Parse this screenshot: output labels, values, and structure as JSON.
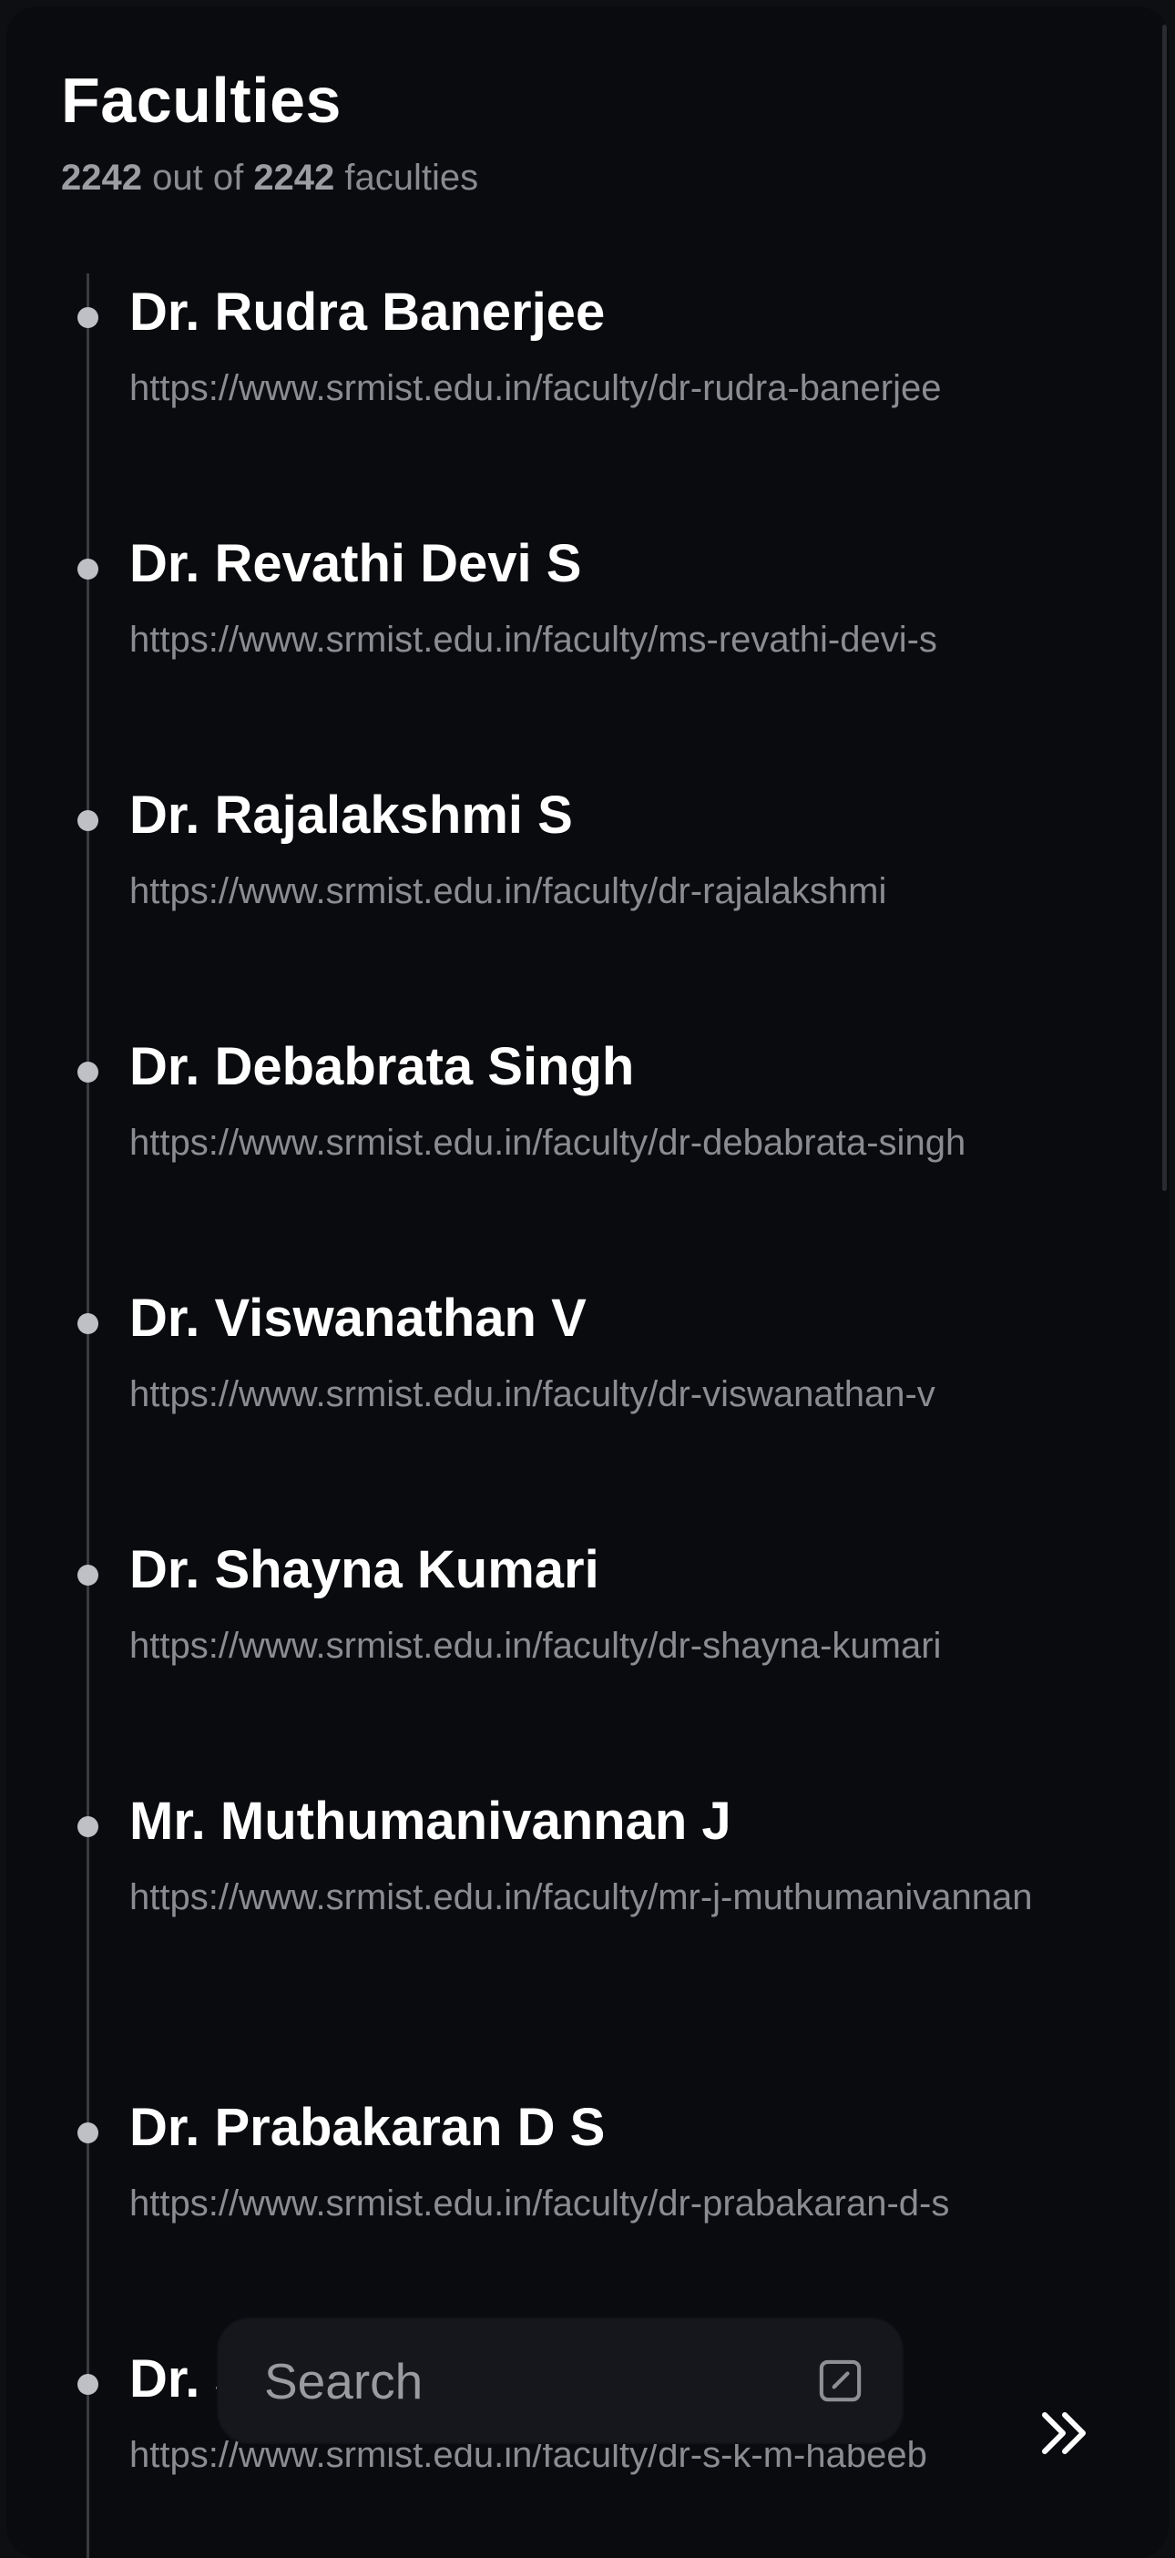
{
  "header": {
    "title": "Faculties",
    "shown_count": "2242",
    "out_of": "out of",
    "total_count": "2242",
    "unit": "faculties"
  },
  "faculties": [
    {
      "name": "Dr. Rudra Banerjee",
      "url": "https://www.srmist.edu.in/faculty/dr-rudra-banerjee"
    },
    {
      "name": "Dr. Revathi Devi S",
      "url": "https://www.srmist.edu.in/faculty/ms-revathi-devi-s"
    },
    {
      "name": "Dr. Rajalakshmi S",
      "url": "https://www.srmist.edu.in/faculty/dr-rajalakshmi"
    },
    {
      "name": "Dr. Debabrata Singh",
      "url": "https://www.srmist.edu.in/faculty/dr-debabrata-singh"
    },
    {
      "name": "Dr. Viswanathan V",
      "url": "https://www.srmist.edu.in/faculty/dr-viswanathan-v"
    },
    {
      "name": "Dr. Shayna Kumari",
      "url": "https://www.srmist.edu.in/faculty/dr-shayna-kumari"
    },
    {
      "name": "Mr. Muthumanivannan J",
      "url": "https://www.srmist.edu.in/faculty/mr-j-muthumanivannan"
    },
    {
      "name": "Dr. Prabakaran D S",
      "url": "https://www.srmist.edu.in/faculty/dr-prabakaran-d-s"
    },
    {
      "name": "Dr. S",
      "url": "https://www.srmist.edu.in/faculty/dr-s-k-m-habeeb"
    }
  ],
  "search": {
    "placeholder": "Search",
    "value": ""
  },
  "icons": {
    "edit": "edit-square-icon",
    "next": "double-chevron-right-icon"
  },
  "colors": {
    "background": "#0a0b0e",
    "text_primary": "#ffffff",
    "text_secondary": "#8b8c92",
    "timeline_dot": "#bfc0c6"
  }
}
